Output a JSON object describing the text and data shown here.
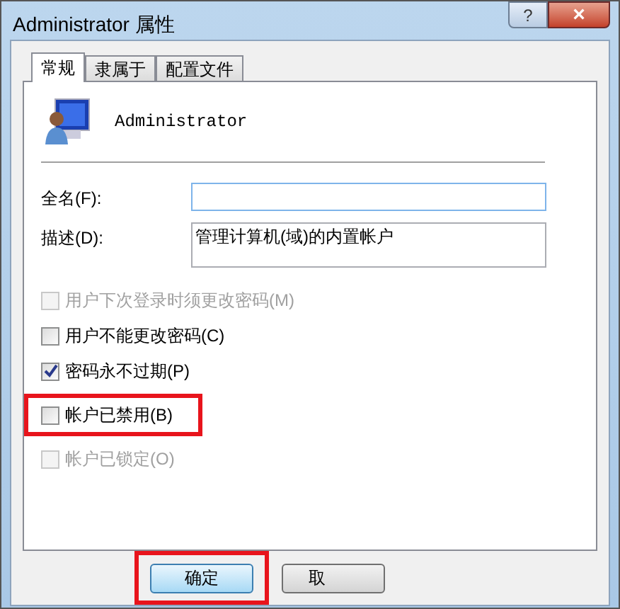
{
  "window": {
    "title": "Administrator 属性",
    "help": "?",
    "close": "×"
  },
  "tabs": [
    {
      "label": "常规",
      "selected": true
    },
    {
      "label": "隶属于",
      "selected": false
    },
    {
      "label": "配置文件",
      "selected": false
    }
  ],
  "user": {
    "name": "Administrator"
  },
  "fields": [
    {
      "label": "全名(F):",
      "kind": "line"
    },
    {
      "label": "描述(D):",
      "value": "管理计算机(域)的内置帐户",
      "kind": "area"
    }
  ],
  "options": [
    {
      "label": "用户下次登录时须更改密码(M)",
      "checked": false,
      "disabled": true,
      "highlighted": false
    },
    {
      "label": "用户不能更改密码(C)",
      "checked": false,
      "disabled": false,
      "highlighted": false
    },
    {
      "label": "密码永不过期(P)",
      "checked": true,
      "disabled": false,
      "highlighted": false
    },
    {
      "label": "帐户已禁用(B)",
      "checked": false,
      "disabled": false,
      "highlighted": true
    },
    {
      "label": "帐户已锁定(O)",
      "checked": false,
      "disabled": true,
      "highlighted": false
    }
  ],
  "buttons": [
    {
      "label": "确定",
      "highlighted": true
    },
    {
      "label": "取",
      "highlighted": false
    }
  ]
}
